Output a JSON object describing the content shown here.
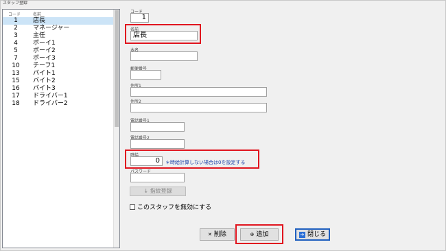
{
  "window": {
    "title": "スタッフ登録"
  },
  "list": {
    "header": {
      "code": "コード",
      "name": "名前"
    },
    "rows": [
      {
        "code": "1",
        "name": "店長"
      },
      {
        "code": "2",
        "name": "マネージャー"
      },
      {
        "code": "3",
        "name": "主任"
      },
      {
        "code": "4",
        "name": "ボーイ1"
      },
      {
        "code": "5",
        "name": "ボーイ2"
      },
      {
        "code": "7",
        "name": "ボーイ3"
      },
      {
        "code": "10",
        "name": "チーフ1"
      },
      {
        "code": "13",
        "name": "バイト1"
      },
      {
        "code": "15",
        "name": "バイト2"
      },
      {
        "code": "16",
        "name": "バイト3"
      },
      {
        "code": "17",
        "name": "ドライバー1"
      },
      {
        "code": "18",
        "name": "ドライバー2"
      }
    ]
  },
  "form": {
    "code": {
      "label": "コード",
      "value": "1"
    },
    "name": {
      "label": "名前",
      "value": "店長"
    },
    "real_name": {
      "label": "本名",
      "value": ""
    },
    "postal": {
      "label": "郵便番号",
      "value": ""
    },
    "address1": {
      "label": "住所1",
      "value": ""
    },
    "address2": {
      "label": "住所2",
      "value": ""
    },
    "phone1": {
      "label": "電話番号1",
      "value": ""
    },
    "phone2": {
      "label": "電話番号2",
      "value": ""
    },
    "hourly": {
      "label": "時給",
      "value": "0",
      "note": "＊時給計算しない場合は0を設定する"
    },
    "password": {
      "label": "パスワード",
      "value": ""
    },
    "fingerprint_button": "指紋登録",
    "disable_checkbox": "このスタッフを無効にする"
  },
  "buttons": {
    "delete": "削除",
    "add": "追加",
    "close": "閉じる"
  }
}
